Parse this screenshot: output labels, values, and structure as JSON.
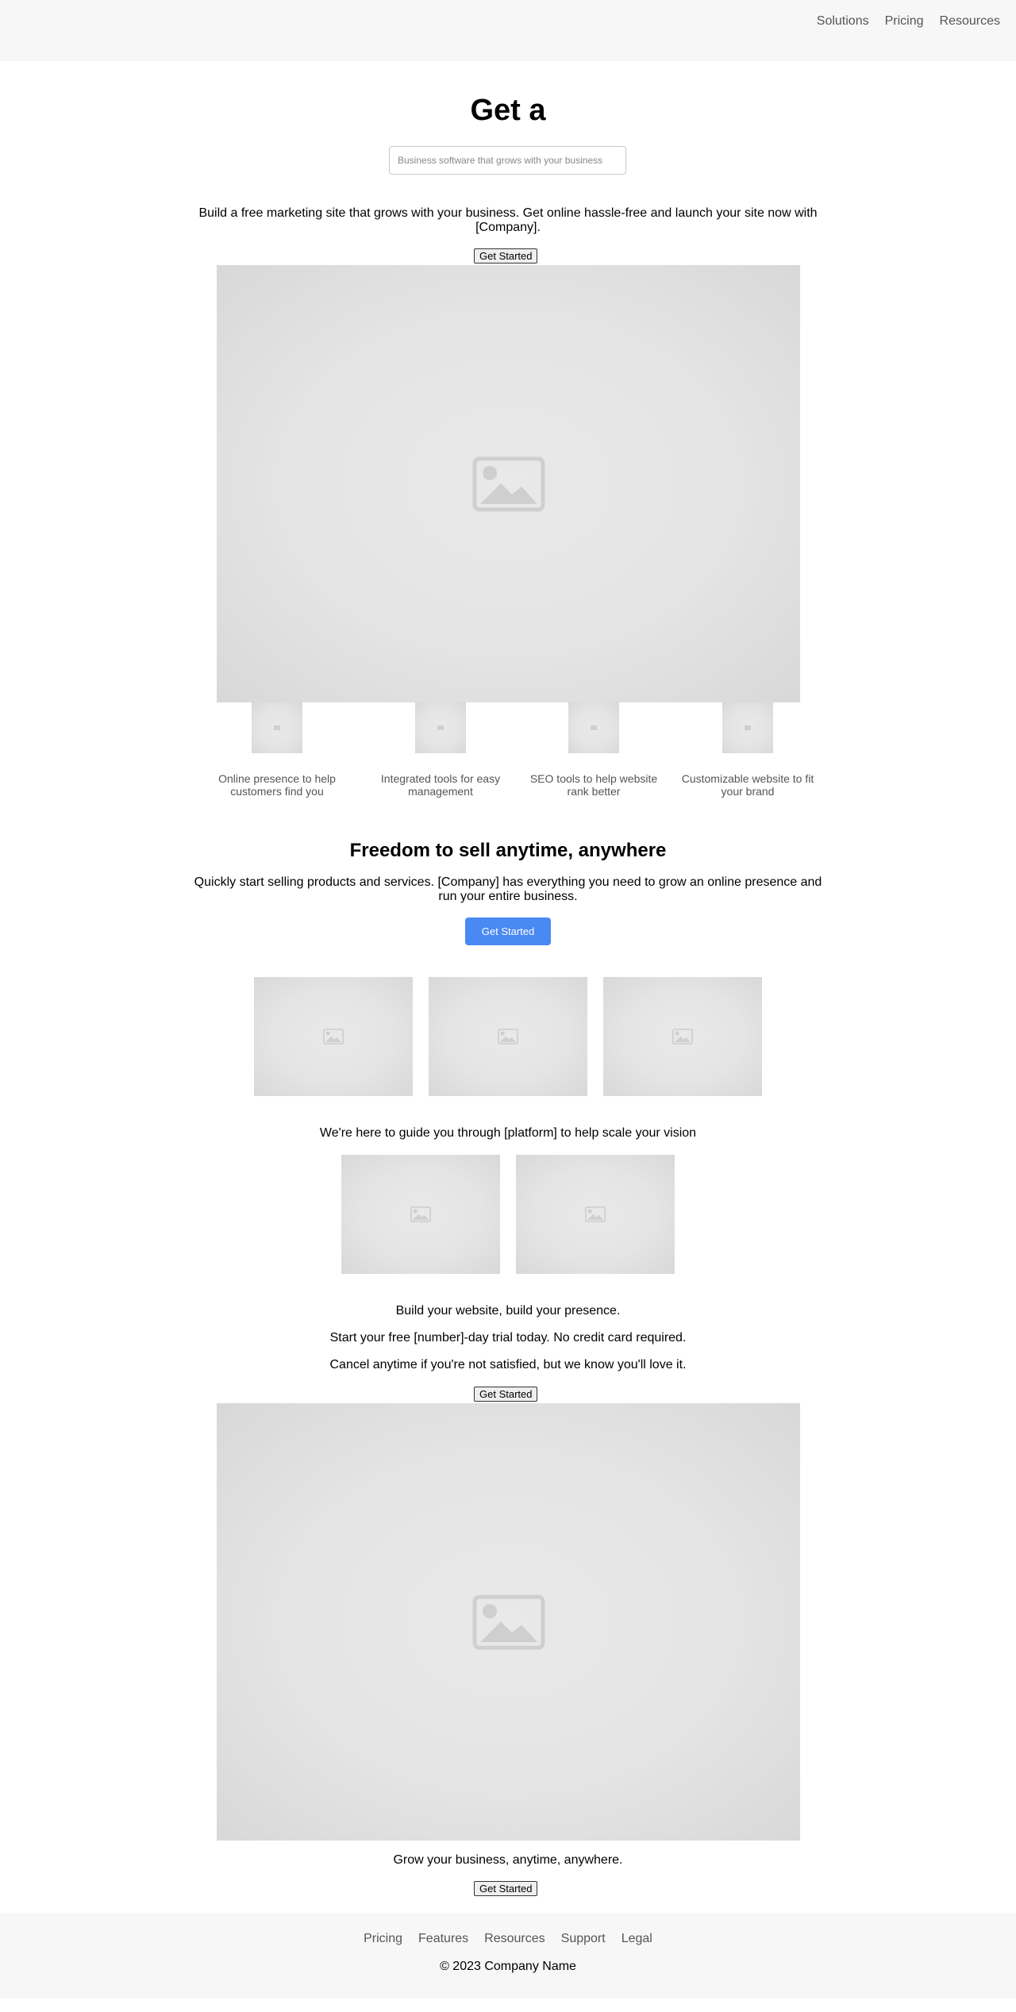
{
  "header": {
    "nav": [
      "Solutions",
      "Pricing",
      "Resources"
    ]
  },
  "hero": {
    "title": "Get a",
    "search_placeholder": "Business software that grows with your business",
    "intro": "Build a free marketing site that grows with your business. Get online hassle-free and launch your site now with [Company].",
    "cta": "Get Started"
  },
  "features": [
    {
      "label": "Online presence to help customers find you",
      "icon": "image-placeholder-icon"
    },
    {
      "label": "Integrated tools for easy management",
      "icon": "image-placeholder-icon"
    },
    {
      "label": "SEO tools to help website rank better",
      "icon": "image-placeholder-icon"
    },
    {
      "label": "Customizable website to fit your brand",
      "icon": "image-placeholder-icon"
    }
  ],
  "sell": {
    "title": "Freedom to sell anytime, anywhere",
    "text": "Quickly start selling products and services. [Company] has everything you need to grow an online presence and run your entire business.",
    "cta": "Get Started",
    "accent": "#4a89f3"
  },
  "guide": {
    "text": "We're here to guide you through [platform] to help scale your vision"
  },
  "trial": {
    "line1": "Build your website, build your presence.",
    "line2": "Start your free [number]-day trial today. No credit card required.",
    "line3": "Cancel anytime if you're not satisfied, but we know you'll love it.",
    "cta": "Get Started"
  },
  "grow": {
    "text": "Grow your business, anytime, anywhere.",
    "cta": "Get Started"
  },
  "footer": {
    "links": [
      "Pricing",
      "Features",
      "Resources",
      "Support",
      "Legal"
    ],
    "copyright": "© 2023 Company Name"
  }
}
